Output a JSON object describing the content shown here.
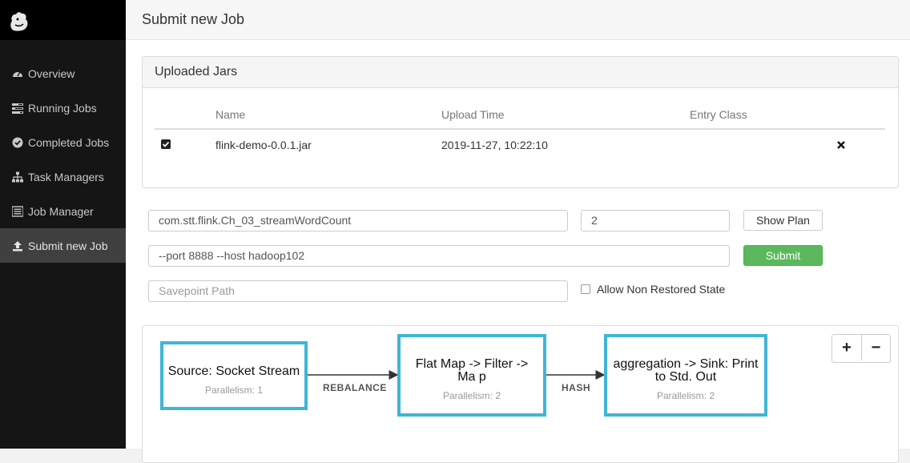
{
  "sidebar": {
    "items": [
      {
        "label": "Overview",
        "icon": "dashboard-icon"
      },
      {
        "label": "Running Jobs",
        "icon": "tasks-icon"
      },
      {
        "label": "Completed Jobs",
        "icon": "check-circle-icon"
      },
      {
        "label": "Task Managers",
        "icon": "sitemap-icon"
      },
      {
        "label": "Job Manager",
        "icon": "list-icon"
      },
      {
        "label": "Submit new Job",
        "icon": "upload-icon",
        "active": true
      }
    ]
  },
  "header": {
    "title": "Submit new Job"
  },
  "uploaded_jars": {
    "title": "Uploaded Jars",
    "columns": [
      "Name",
      "Upload Time",
      "Entry Class"
    ],
    "rows": [
      {
        "checked": true,
        "name": "flink-demo-0.0.1.jar",
        "upload_time": "2019-11-27, 10:22:10",
        "entry_class": ""
      }
    ]
  },
  "form": {
    "entry_class_value": "com.stt.flink.Ch_03_streamWordCount",
    "parallelism_value": "2",
    "program_args_value": "--port 8888 --host hadoop102",
    "savepoint_placeholder": "Savepoint Path",
    "show_plan_label": "Show Plan",
    "submit_label": "Submit",
    "allow_non_restored_label": "Allow Non Restored State",
    "allow_non_restored_checked": false
  },
  "plan": {
    "nodes": [
      {
        "title": "Source: Socket Stream",
        "parallelism": "Parallelism: 1"
      },
      {
        "title": "Flat Map -> Filter -> Ma p",
        "parallelism": "Parallelism: 2"
      },
      {
        "title": "aggregation -> Sink: Print to Std. Out",
        "parallelism": "Parallelism: 2"
      }
    ],
    "edges": [
      {
        "label": "REBALANCE"
      },
      {
        "label": "HASH"
      }
    ],
    "zoom_in_label": "+",
    "zoom_out_label": "−"
  },
  "colors": {
    "sidebar_bg": "#151515",
    "node_border": "#3fb5d7",
    "submit_green": "#5cb85c"
  }
}
